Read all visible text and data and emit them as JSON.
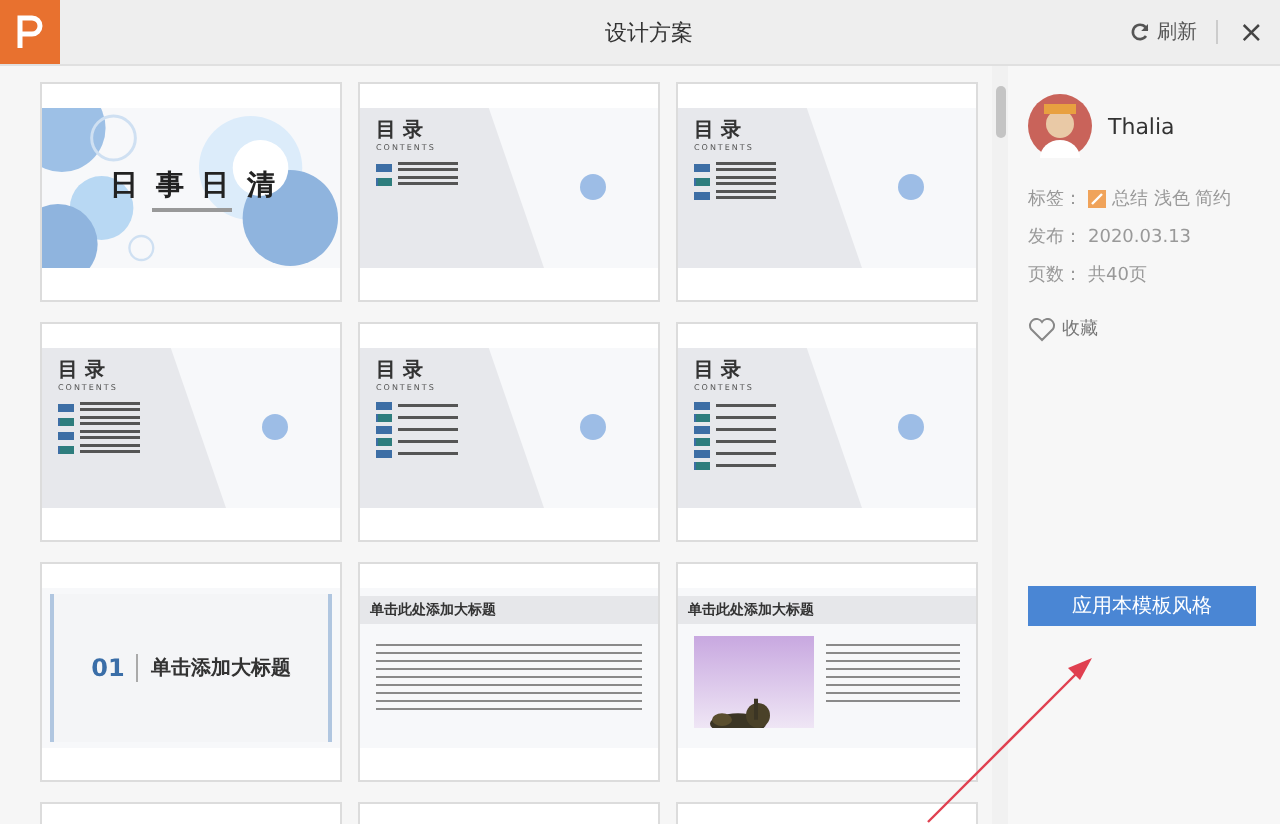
{
  "window": {
    "title": "设计方案",
    "refresh": "刷新",
    "close": "×"
  },
  "slides": [
    {
      "kind": "cover",
      "title": "日 事 日 清"
    },
    {
      "kind": "toc",
      "title": "目 录",
      "subtitle": "CONTENTS",
      "entries": [
        {
          "color": "#3d6ea5"
        },
        {
          "color": "#2e7d7d"
        }
      ]
    },
    {
      "kind": "toc",
      "title": "目 录",
      "subtitle": "CONTENTS",
      "entries": [
        {
          "color": "#3d6ea5"
        },
        {
          "color": "#2e7d7d"
        },
        {
          "color": "#3d6ea5"
        }
      ]
    },
    {
      "kind": "toc",
      "title": "目 录",
      "subtitle": "CONTENTS",
      "entries": [
        {
          "color": "#3d6ea5"
        },
        {
          "color": "#2e7d7d"
        },
        {
          "color": "#3d6ea5"
        },
        {
          "color": "#2e7d7d"
        }
      ]
    },
    {
      "kind": "toc",
      "title": "目 录",
      "subtitle": "CONTENTS",
      "entries": [
        {
          "color": "#3d6ea5"
        },
        {
          "color": "#2e7d7d"
        },
        {
          "color": "#3d6ea5"
        },
        {
          "color": "#2e7d7d"
        },
        {
          "color": "#3d6ea5"
        }
      ]
    },
    {
      "kind": "toc",
      "title": "目 录",
      "subtitle": "CONTENTS",
      "entries": [
        {
          "color": "#3d6ea5"
        },
        {
          "color": "#2e7d7d"
        },
        {
          "color": "#3d6ea5"
        },
        {
          "color": "#2e7d7d"
        },
        {
          "color": "#3d6ea5"
        },
        {
          "color": "#2e7d7d"
        }
      ]
    },
    {
      "kind": "section",
      "number": "01",
      "title": "单击添加大标题"
    },
    {
      "kind": "bullets",
      "title": "单击此处添加大标题"
    },
    {
      "kind": "picture",
      "title": "单击此处添加大标题"
    },
    {
      "kind": "cutoff"
    },
    {
      "kind": "cutoff"
    },
    {
      "kind": "cutoff"
    }
  ],
  "author": {
    "name": "Thalia"
  },
  "details": [
    {
      "kind": "tags",
      "label": "标签：",
      "value": "总结 浅色 简约"
    },
    {
      "kind": "text",
      "label": "发布：",
      "value": "2020.03.13"
    },
    {
      "kind": "text",
      "label": "页数：",
      "value": "共40页"
    }
  ],
  "favorite": {
    "label": "收藏"
  },
  "apply_button": "应用本模板风格"
}
